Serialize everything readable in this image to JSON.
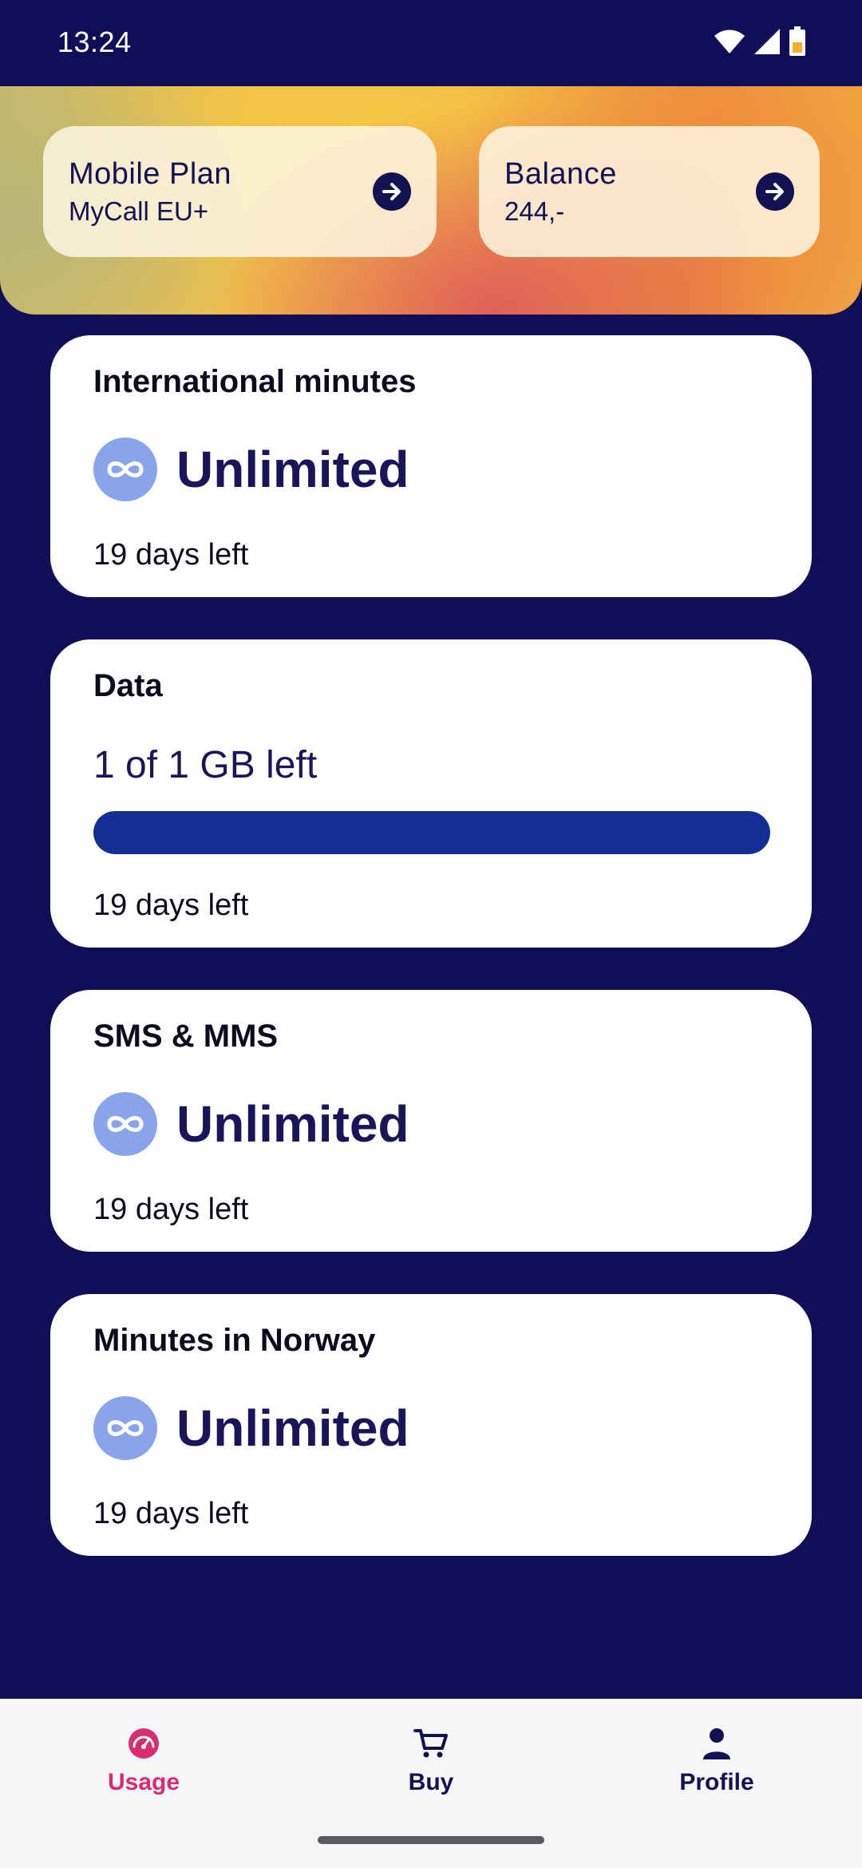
{
  "status_bar": {
    "time": "13:24"
  },
  "header": {
    "plan_card": {
      "title": "Mobile Plan",
      "value": "MyCall EU+"
    },
    "balance_card": {
      "title": "Balance",
      "value": "244,-"
    }
  },
  "cards": {
    "international": {
      "title": "International minutes",
      "value": "Unlimited",
      "footer": "19 days left"
    },
    "data": {
      "title": "Data",
      "amount": "1 of 1 GB left",
      "remaining_fraction": 1.0,
      "footer": "19 days left"
    },
    "sms": {
      "title": "SMS & MMS",
      "value": "Unlimited",
      "footer": "19 days left"
    },
    "norway": {
      "title": "Minutes in Norway",
      "value": "Unlimited",
      "footer": "19 days left"
    }
  },
  "bottom_nav": {
    "items": [
      {
        "label": "Usage",
        "icon": "speedometer-icon",
        "active": true
      },
      {
        "label": "Buy",
        "icon": "cart-icon",
        "active": false
      },
      {
        "label": "Profile",
        "icon": "person-icon",
        "active": false
      }
    ]
  },
  "colors": {
    "background": "#120d57",
    "accent_active": "#d92b6e",
    "progress_fill": "#152e96",
    "infinity_badge": "#8aa4ec"
  }
}
